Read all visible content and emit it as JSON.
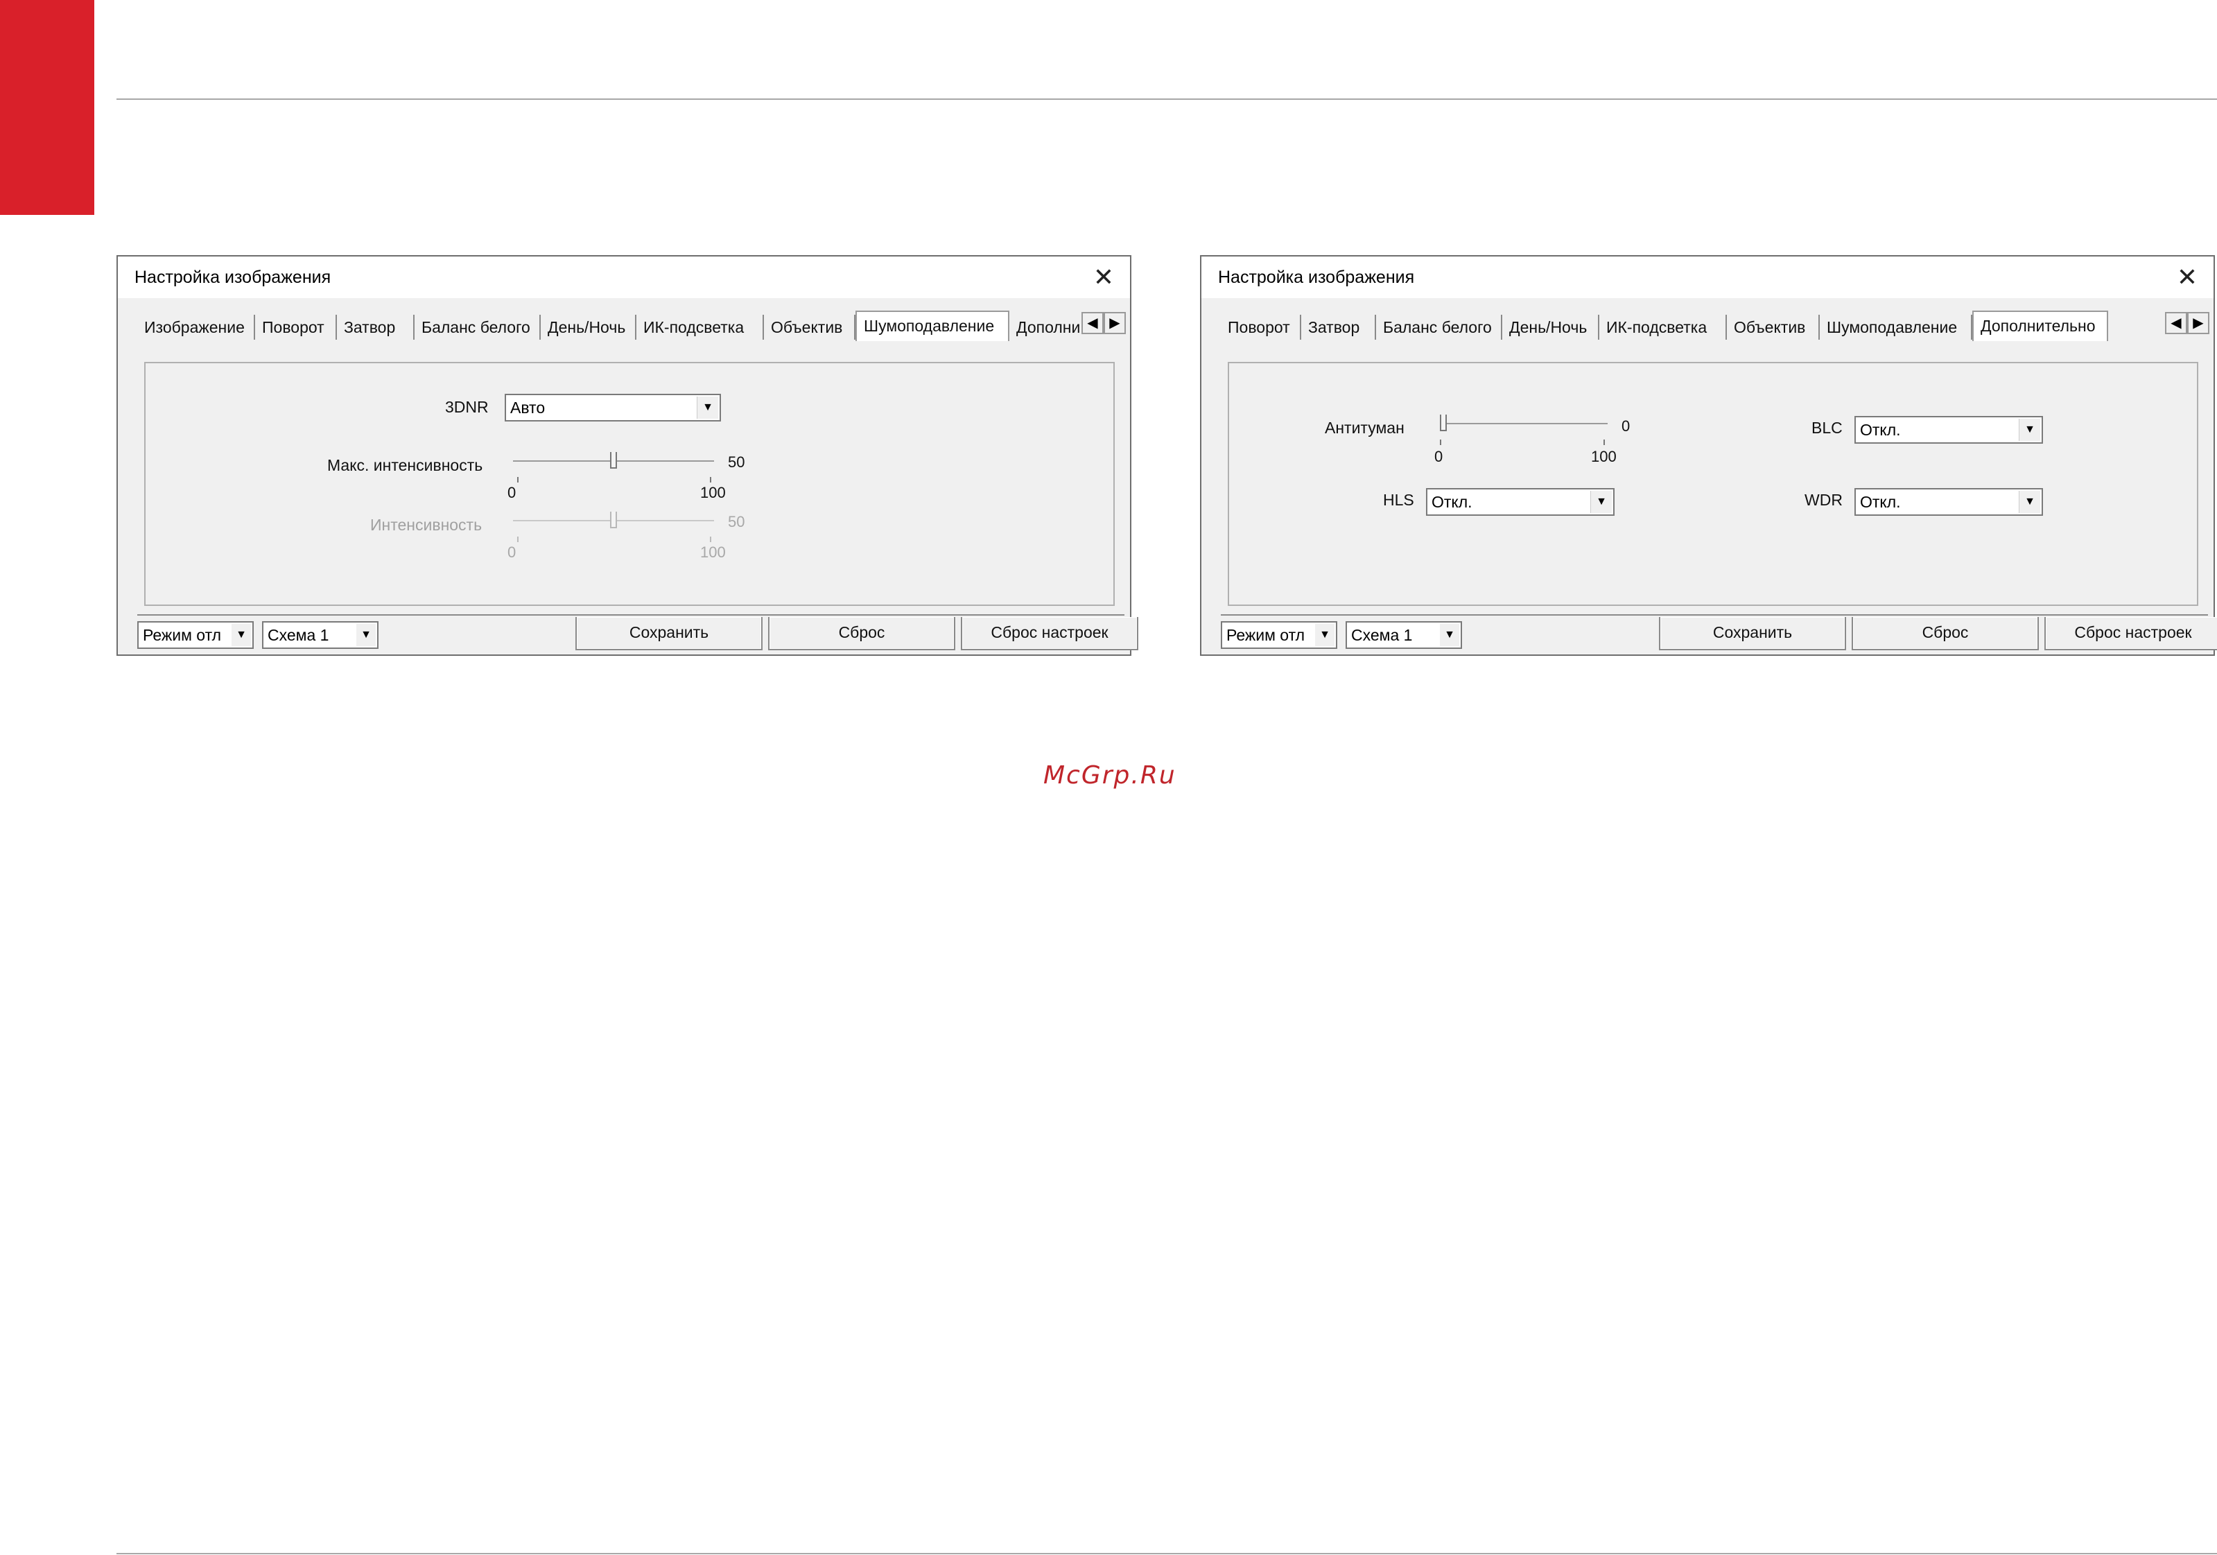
{
  "colors": {
    "accent": "#d9202a",
    "watermark": "#c0252b"
  },
  "watermark": "McGrp.Ru",
  "dialog1": {
    "title": "Настройка изображения",
    "close_icon": "close-icon",
    "tabs": [
      "Изображение",
      "Поворот",
      "Затвор",
      "Баланс белого",
      "День/Ночь",
      "ИК-подсветка",
      "Объектив",
      "Шумоподавление",
      "Дополни"
    ],
    "active_tab": "Шумоподавление",
    "dnr_label": "3DNR",
    "dnr_value": "Авто",
    "max_intensity_label": "Макс. интенсивность",
    "max_intensity_value": "50",
    "max_intensity_min": "0",
    "max_intensity_max": "100",
    "intensity_label": "Интенсивность",
    "intensity_value": "50",
    "intensity_min": "0",
    "intensity_max": "100",
    "mode_value": "Режим отл",
    "scheme_value": "Схема 1",
    "save_label": "Сохранить",
    "reset_label": "Сброс",
    "reset_settings_label": "Сброс настроек"
  },
  "dialog2": {
    "title": "Настройка изображения",
    "close_icon": "close-icon",
    "tabs": [
      "Поворот",
      "Затвор",
      "Баланс белого",
      "День/Ночь",
      "ИК-подсветка",
      "Объектив",
      "Шумоподавление",
      "Дополнительно"
    ],
    "active_tab": "Дополнительно",
    "antifog_label": "Антитуман",
    "antifog_value": "0",
    "antifog_min": "0",
    "antifog_max": "100",
    "blc_label": "BLC",
    "blc_value": "Откл.",
    "hls_label": "HLS",
    "hls_value": "Откл.",
    "wdr_label": "WDR",
    "wdr_value": "Откл.",
    "mode_value": "Режим отл",
    "scheme_value": "Схема 1",
    "save_label": "Сохранить",
    "reset_label": "Сброс",
    "reset_settings_label": "Сброс настроек"
  }
}
